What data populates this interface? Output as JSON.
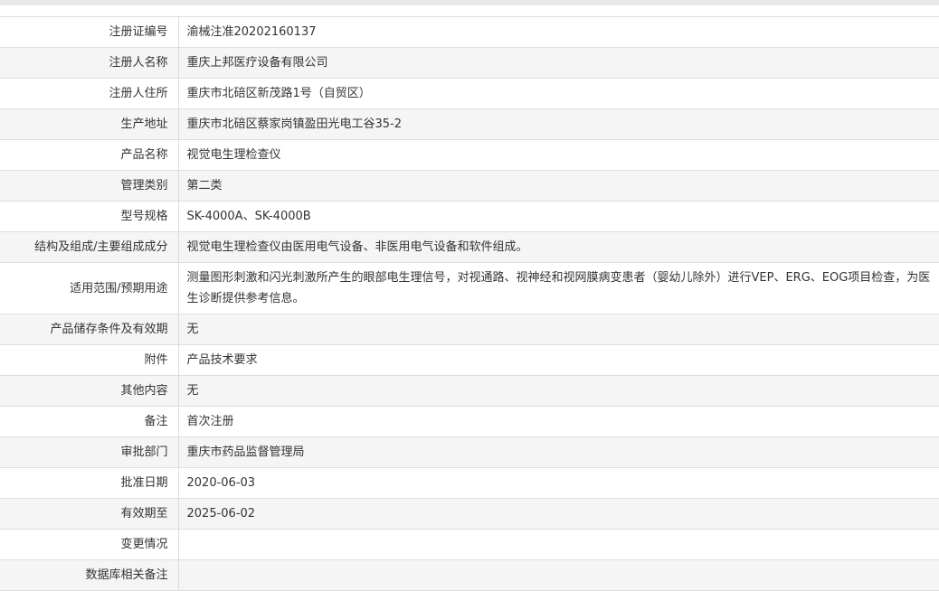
{
  "rows": [
    {
      "label": "注册证编号",
      "value": "渝械注准20202160137"
    },
    {
      "label": "注册人名称",
      "value": "重庆上邦医疗设备有限公司"
    },
    {
      "label": "注册人住所",
      "value": "重庆市北碚区新茂路1号（自贸区）"
    },
    {
      "label": "生产地址",
      "value": "重庆市北碚区蔡家岗镇盈田光电工谷35-2"
    },
    {
      "label": "产品名称",
      "value": "视觉电生理检查仪"
    },
    {
      "label": "管理类别",
      "value": "第二类"
    },
    {
      "label": "型号规格",
      "value": "SK-4000A、SK-4000B"
    },
    {
      "label": "结构及组成/主要组成成分",
      "value": "视觉电生理检查仪由医用电气设备、非医用电气设备和软件组成。"
    },
    {
      "label": "适用范围/预期用途",
      "value": "测量图形刺激和闪光刺激所产生的眼部电生理信号，对视通路、视神经和视网膜病变患者（婴幼儿除外）进行VEP、ERG、EOG项目检查，为医生诊断提供参考信息。"
    },
    {
      "label": "产品储存条件及有效期",
      "value": "无"
    },
    {
      "label": "附件",
      "value": "产品技术要求"
    },
    {
      "label": "其他内容",
      "value": "无"
    },
    {
      "label": "备注",
      "value": "首次注册"
    },
    {
      "label": "审批部门",
      "value": "重庆市药品监督管理局"
    },
    {
      "label": "批准日期",
      "value": "2020-06-03"
    },
    {
      "label": "有效期至",
      "value": "2025-06-02"
    },
    {
      "label": "变更情况",
      "value": ""
    },
    {
      "label": "数据库相关备注",
      "value": ""
    }
  ]
}
